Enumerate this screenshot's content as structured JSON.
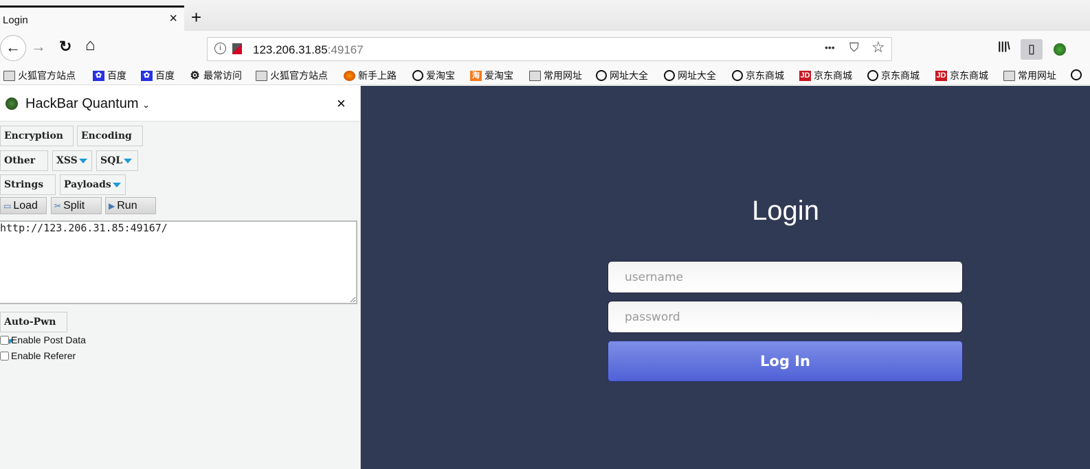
{
  "tab": {
    "title": "Login",
    "close": "×",
    "new_tab": "+"
  },
  "nav": {
    "back": "←",
    "forward": "→",
    "reload": "↻",
    "home": "⌂",
    "url_host": "123.206.31.85",
    "url_port": ":49167",
    "more": "•••",
    "pocket": "⛉",
    "star": "☆",
    "library": "|||\\",
    "sidebar_toggle": "▯"
  },
  "bookmarks": [
    {
      "label": "火狐官方站点",
      "icon": "folder"
    },
    {
      "label": "百度",
      "icon": "baidu"
    },
    {
      "label": "百度",
      "icon": "baidu"
    },
    {
      "label": "最常访问",
      "icon": "gear"
    },
    {
      "label": "火狐官方站点",
      "icon": "folder"
    },
    {
      "label": "新手上路",
      "icon": "firefox"
    },
    {
      "label": "爱淘宝",
      "icon": "globe"
    },
    {
      "label": "爱淘宝",
      "icon": "taobao"
    },
    {
      "label": "常用网址",
      "icon": "folder"
    },
    {
      "label": "网址大全",
      "icon": "globe"
    },
    {
      "label": "网址大全",
      "icon": "globe"
    },
    {
      "label": "京东商城",
      "icon": "globe"
    },
    {
      "label": "京东商城",
      "icon": "jd"
    },
    {
      "label": "京东商城",
      "icon": "globe"
    },
    {
      "label": "京东商城",
      "icon": "jd"
    },
    {
      "label": "常用网址",
      "icon": "folder"
    }
  ],
  "hackbar": {
    "title": "HackBar Quantum",
    "close": "×",
    "menus": [
      "Encryption",
      "Encoding",
      "Other",
      "XSS",
      "SQL",
      "Strings",
      "Payloads"
    ],
    "actions": [
      "Load",
      "Split",
      "Run"
    ],
    "url_value": "http://123.206.31.85:49167/",
    "autopwn": "Auto-Pwn",
    "enable_post": "Enable Post Data",
    "enable_referer": "Enable Referer"
  },
  "login": {
    "title": "Login",
    "username_placeholder": "username",
    "password_placeholder": "password",
    "submit": "Log In"
  },
  "colors": {
    "page_bg": "#313a55",
    "button": "#5c6ddc",
    "hackbar_arrow": "#1e9ad6"
  }
}
